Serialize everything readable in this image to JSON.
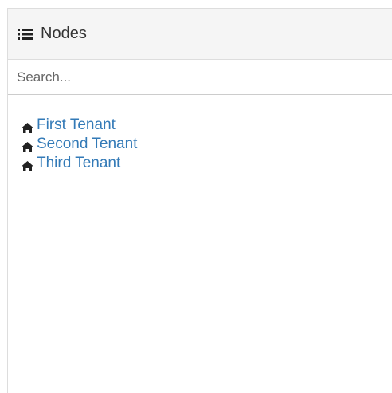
{
  "panel": {
    "title": "Nodes",
    "title_icon": "list-icon"
  },
  "search": {
    "placeholder": "Search..."
  },
  "tree": {
    "items": [
      {
        "label": "First Tenant",
        "icon": "home-icon"
      },
      {
        "label": "Second Tenant",
        "icon": "home-icon"
      },
      {
        "label": "Third Tenant",
        "icon": "home-icon"
      }
    ]
  },
  "colors": {
    "link": "#337ab7",
    "heading_bg": "#f5f5f5",
    "border": "#dddddd"
  }
}
